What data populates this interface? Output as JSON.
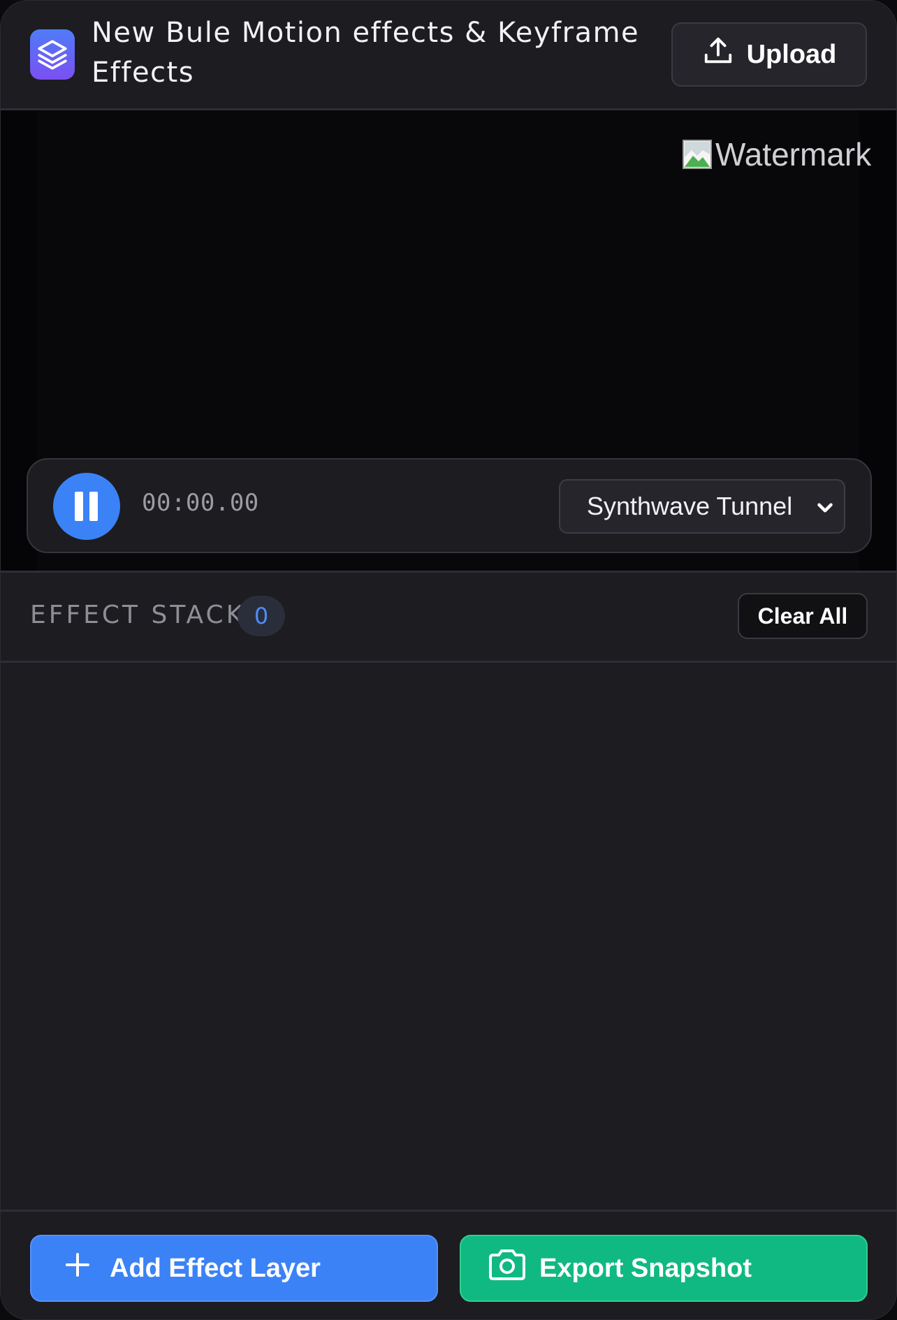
{
  "header": {
    "title": "New Bule Motion effects & Keyframe Effects",
    "upload_label": "Upload",
    "logo_icon": "layers-icon"
  },
  "preview": {
    "watermark_alt": "Watermark"
  },
  "playback": {
    "state": "playing",
    "timecode": "00:00.00",
    "preset_selected": "Synthwave Tunnel"
  },
  "effect_stack": {
    "title": "EFFECT STACK",
    "count": "0",
    "clear_label": "Clear All",
    "items": []
  },
  "footer": {
    "add_label": "Add Effect Layer",
    "export_label": "Export Snapshot"
  },
  "colors": {
    "accent_blue": "#3b82f6",
    "accent_green": "#10b981",
    "background": "#1c1c21"
  }
}
